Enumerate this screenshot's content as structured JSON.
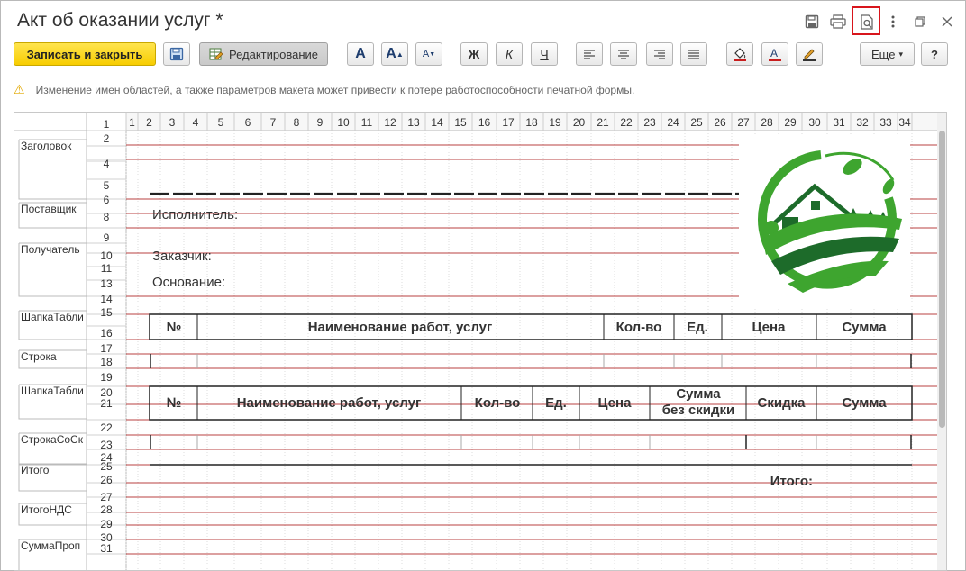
{
  "window": {
    "title": "Акт об оказании услуг *"
  },
  "title_icons": [
    "save-icon",
    "print-icon",
    "preview-icon",
    "more-vertical-icon",
    "restore-window-icon",
    "close-icon"
  ],
  "toolbar": {
    "save_close": "Записать и закрыть",
    "edit": "Редактирование",
    "font_bold_A": "A",
    "font_increase": "A",
    "font_decrease": "A",
    "bold": "Ж",
    "italic": "К",
    "underline": "Ч",
    "more": "Еще",
    "more_arrow": "▾",
    "help": "?"
  },
  "warning": {
    "text": "Изменение имен областей, а также параметров макета может привести к потере работоспособности печатной формы."
  },
  "colors": {
    "primary": "#f7cd00",
    "highlight": "#d8151c",
    "rowline": "#a30000",
    "grid": "#dcdcdc",
    "logo_green": "#3ea52f"
  },
  "sheet": {
    "columns": [
      "1",
      "2",
      "3",
      "4",
      "5",
      "6",
      "7",
      "8",
      "9",
      "10",
      "11",
      "12",
      "13",
      "14",
      "15",
      "16",
      "17",
      "18",
      "19",
      "20",
      "21",
      "22",
      "23",
      "24",
      "25",
      "26",
      "27",
      "28",
      "29",
      "30",
      "31",
      "32",
      "33",
      "34"
    ],
    "rows": [
      "1",
      "2",
      "4",
      "5",
      "6",
      "8",
      "9",
      "10",
      "11",
      "13",
      "14",
      "15",
      "16",
      "17",
      "18",
      "19",
      "20",
      "21",
      "22",
      "23",
      "24",
      "25",
      "26",
      "27",
      "28",
      "29",
      "30",
      "31"
    ],
    "areas": [
      {
        "name": "Заголовок"
      },
      {
        "name": "Поставщик"
      },
      {
        "name": "Получатель"
      },
      {
        "name": "ШапкаТабли"
      },
      {
        "name": "Строка"
      },
      {
        "name": "ШапкаТабли"
      },
      {
        "name": "СтрокаСоСк"
      },
      {
        "name": "Итого"
      },
      {
        "name": "ИтогоНДС"
      },
      {
        "name": "СуммаПроп"
      }
    ],
    "labels": {
      "executor": "Исполнитель:",
      "customer": "Заказчик:",
      "basis": "Основание:",
      "total": "Итого:"
    },
    "table1": [
      "№",
      "Наименование работ, услуг",
      "Кол-во",
      "Ед.",
      "Цена",
      "Сумма"
    ],
    "table2": [
      "№",
      "Наименование работ, услуг",
      "Кол-во",
      "Ед.",
      "Цена",
      "Сумма",
      "без скидки",
      "Скидка",
      "Сумма"
    ]
  }
}
